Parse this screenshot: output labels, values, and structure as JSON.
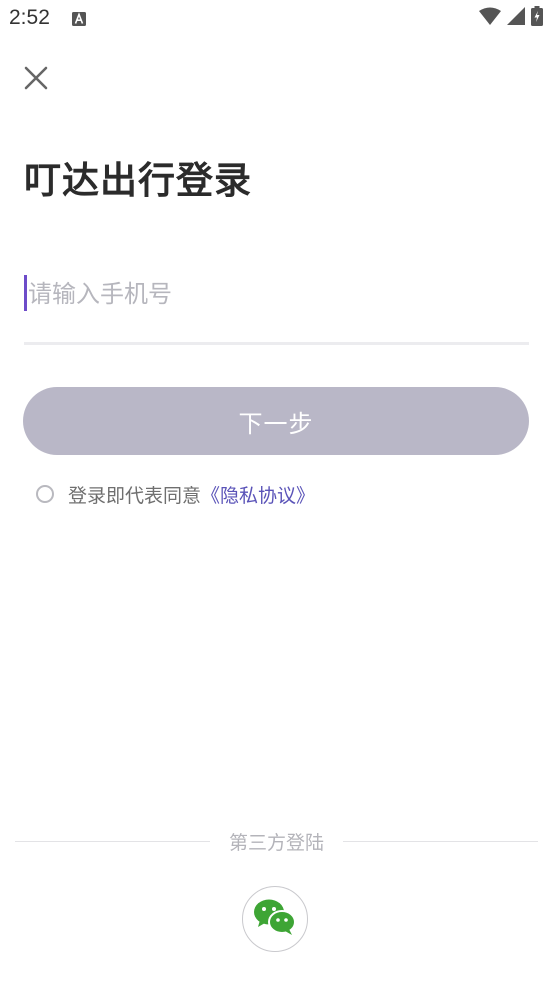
{
  "status_bar": {
    "time": "2:52",
    "notification_icon": "a-notification-icon",
    "icons": [
      "wifi-icon",
      "signal-icon",
      "battery-charging-icon"
    ]
  },
  "header": {
    "close_icon": "close-icon",
    "title": "叮达出行登录"
  },
  "login_form": {
    "phone_placeholder": "请输入手机号",
    "phone_value": "",
    "next_button_label": "下一步",
    "agreement_text": "登录即代表同意",
    "privacy_link": "《隐私协议》"
  },
  "third_party": {
    "label": "第三方登陆",
    "wechat_icon": "wechat-icon"
  },
  "colors": {
    "button_bg": "#b9b7c7",
    "link": "#5a53b8",
    "caret": "#6d4cc9",
    "wechat_green": "#3ea535"
  }
}
